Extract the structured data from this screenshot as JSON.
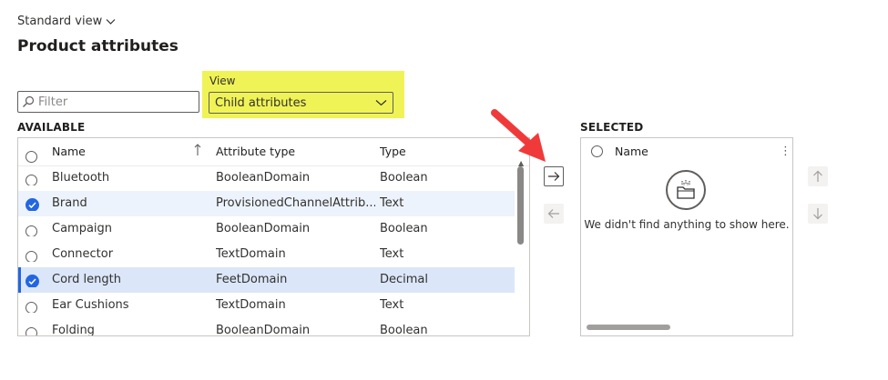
{
  "header": {
    "view_selector": "Standard view",
    "title": "Product attributes"
  },
  "filter": {
    "placeholder": "Filter",
    "value": ""
  },
  "view": {
    "label": "View",
    "selected": "Child attributes"
  },
  "available": {
    "label": "AVAILABLE",
    "columns": {
      "name": "Name",
      "attribute_type": "Attribute type",
      "type": "Type"
    },
    "rows": [
      {
        "name": "Bluetooth",
        "attribute_type": "BooleanDomain",
        "type": "Boolean",
        "checked": false
      },
      {
        "name": "Brand",
        "attribute_type": "ProvisionedChannelAttrib...",
        "type": "Text",
        "checked": true
      },
      {
        "name": "Campaign",
        "attribute_type": "BooleanDomain",
        "type": "Boolean",
        "checked": false
      },
      {
        "name": "Connector",
        "attribute_type": "TextDomain",
        "type": "Text",
        "checked": false
      },
      {
        "name": "Cord length",
        "attribute_type": "FeetDomain",
        "type": "Decimal",
        "checked": true
      },
      {
        "name": "Ear Cushions",
        "attribute_type": "TextDomain",
        "type": "Text",
        "checked": false
      },
      {
        "name": "Folding",
        "attribute_type": "BooleanDomain",
        "type": "Boolean",
        "checked": false
      }
    ]
  },
  "selected": {
    "label": "SELECTED",
    "columns": {
      "name": "Name"
    },
    "empty_message": "We didn't find anything to show here."
  },
  "colors": {
    "accent": "#2266e3",
    "highlight": "#f0f356",
    "arrow": "#f03a3a"
  }
}
